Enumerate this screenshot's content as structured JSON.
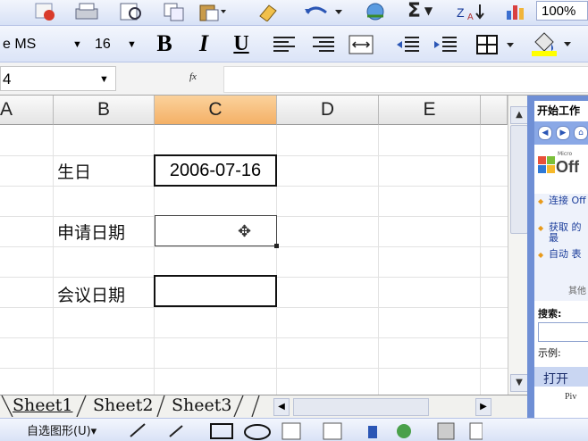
{
  "toolbar1": {
    "zoom_value": "100%"
  },
  "toolbar2": {
    "font_name": "e MS",
    "font_size": "16",
    "bold_label": "B",
    "italic_label": "I",
    "underline_label": "U"
  },
  "formula_bar": {
    "name_box": "4",
    "fx_label": "fx"
  },
  "columns": [
    "A",
    "B",
    "C",
    "D",
    "E"
  ],
  "selected_column": "C",
  "rows": [
    {
      "label": "生日",
      "value": "2006-07-16"
    },
    {
      "label": "申请日期",
      "value": ""
    },
    {
      "label": "会议日期",
      "value": ""
    }
  ],
  "sheet_tabs": [
    "Sheet1",
    "Sheet2",
    "Sheet3"
  ],
  "task_pane": {
    "title": "开始工作",
    "logo_text": "Off",
    "logo_small": "Micro",
    "links": [
      "连接 Off",
      "获取 的最",
      "自动 表"
    ],
    "other": "其他",
    "search_label": "搜索:",
    "example_label": "示例:",
    "open_label": "打开",
    "piv_label": "Piv"
  },
  "drawing_bar": {
    "autoshapes_label": "自选图形(U)▾"
  }
}
